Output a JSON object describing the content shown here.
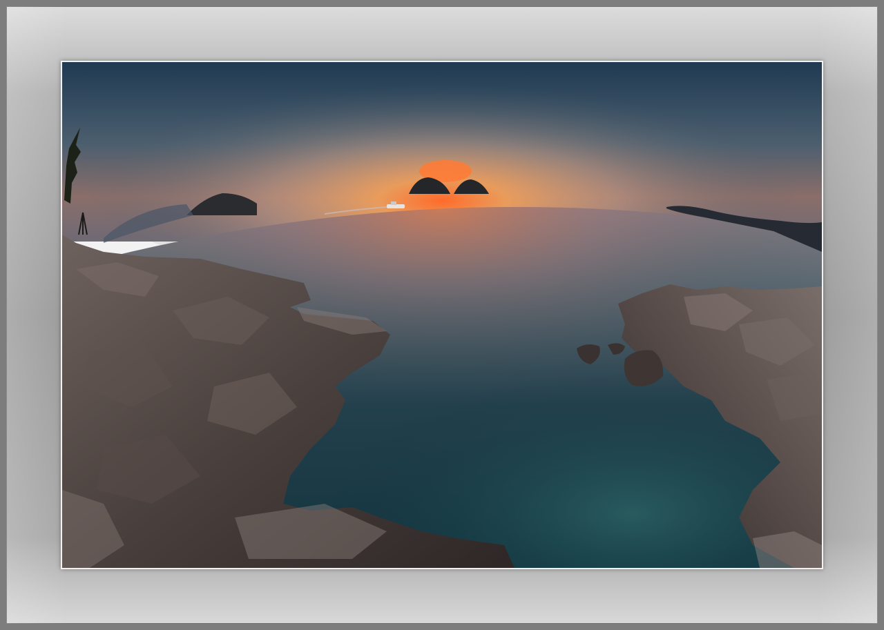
{
  "scene": {
    "subject": "sunset-over-sea",
    "colors": {
      "sky_top": "#1f3a52",
      "sky_glow": "#f4a15a",
      "sun": "#ff6a2a",
      "sea_far": "#8a7f85",
      "sea_near": "#12343f",
      "rock": "#5a4f4c",
      "frame": "#9c9c9c"
    }
  }
}
